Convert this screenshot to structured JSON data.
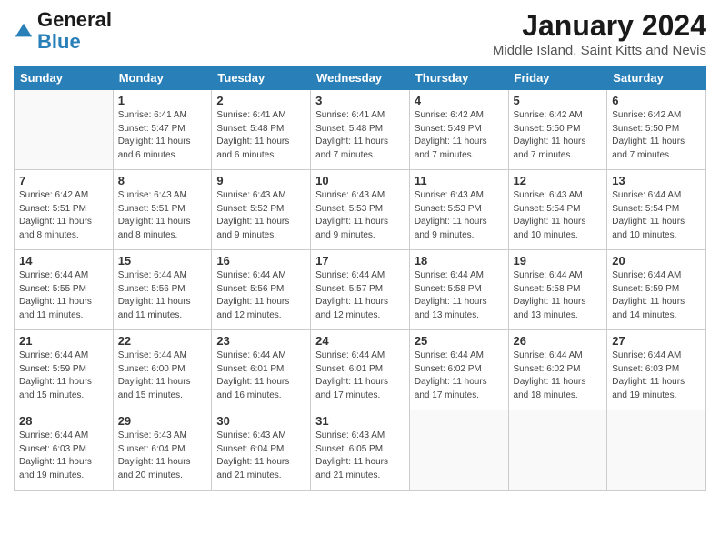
{
  "header": {
    "logo_line1": "General",
    "logo_line2": "Blue",
    "title": "January 2024",
    "subtitle": "Middle Island, Saint Kitts and Nevis"
  },
  "days_of_week": [
    "Sunday",
    "Monday",
    "Tuesday",
    "Wednesday",
    "Thursday",
    "Friday",
    "Saturday"
  ],
  "weeks": [
    [
      {
        "num": "",
        "sunrise": "",
        "sunset": "",
        "daylight": ""
      },
      {
        "num": "1",
        "sunrise": "6:41 AM",
        "sunset": "5:47 PM",
        "daylight": "11 hours and 6 minutes."
      },
      {
        "num": "2",
        "sunrise": "6:41 AM",
        "sunset": "5:48 PM",
        "daylight": "11 hours and 6 minutes."
      },
      {
        "num": "3",
        "sunrise": "6:41 AM",
        "sunset": "5:48 PM",
        "daylight": "11 hours and 7 minutes."
      },
      {
        "num": "4",
        "sunrise": "6:42 AM",
        "sunset": "5:49 PM",
        "daylight": "11 hours and 7 minutes."
      },
      {
        "num": "5",
        "sunrise": "6:42 AM",
        "sunset": "5:50 PM",
        "daylight": "11 hours and 7 minutes."
      },
      {
        "num": "6",
        "sunrise": "6:42 AM",
        "sunset": "5:50 PM",
        "daylight": "11 hours and 7 minutes."
      }
    ],
    [
      {
        "num": "7",
        "sunrise": "6:42 AM",
        "sunset": "5:51 PM",
        "daylight": "11 hours and 8 minutes."
      },
      {
        "num": "8",
        "sunrise": "6:43 AM",
        "sunset": "5:51 PM",
        "daylight": "11 hours and 8 minutes."
      },
      {
        "num": "9",
        "sunrise": "6:43 AM",
        "sunset": "5:52 PM",
        "daylight": "11 hours and 9 minutes."
      },
      {
        "num": "10",
        "sunrise": "6:43 AM",
        "sunset": "5:53 PM",
        "daylight": "11 hours and 9 minutes."
      },
      {
        "num": "11",
        "sunrise": "6:43 AM",
        "sunset": "5:53 PM",
        "daylight": "11 hours and 9 minutes."
      },
      {
        "num": "12",
        "sunrise": "6:43 AM",
        "sunset": "5:54 PM",
        "daylight": "11 hours and 10 minutes."
      },
      {
        "num": "13",
        "sunrise": "6:44 AM",
        "sunset": "5:54 PM",
        "daylight": "11 hours and 10 minutes."
      }
    ],
    [
      {
        "num": "14",
        "sunrise": "6:44 AM",
        "sunset": "5:55 PM",
        "daylight": "11 hours and 11 minutes."
      },
      {
        "num": "15",
        "sunrise": "6:44 AM",
        "sunset": "5:56 PM",
        "daylight": "11 hours and 11 minutes."
      },
      {
        "num": "16",
        "sunrise": "6:44 AM",
        "sunset": "5:56 PM",
        "daylight": "11 hours and 12 minutes."
      },
      {
        "num": "17",
        "sunrise": "6:44 AM",
        "sunset": "5:57 PM",
        "daylight": "11 hours and 12 minutes."
      },
      {
        "num": "18",
        "sunrise": "6:44 AM",
        "sunset": "5:58 PM",
        "daylight": "11 hours and 13 minutes."
      },
      {
        "num": "19",
        "sunrise": "6:44 AM",
        "sunset": "5:58 PM",
        "daylight": "11 hours and 13 minutes."
      },
      {
        "num": "20",
        "sunrise": "6:44 AM",
        "sunset": "5:59 PM",
        "daylight": "11 hours and 14 minutes."
      }
    ],
    [
      {
        "num": "21",
        "sunrise": "6:44 AM",
        "sunset": "5:59 PM",
        "daylight": "11 hours and 15 minutes."
      },
      {
        "num": "22",
        "sunrise": "6:44 AM",
        "sunset": "6:00 PM",
        "daylight": "11 hours and 15 minutes."
      },
      {
        "num": "23",
        "sunrise": "6:44 AM",
        "sunset": "6:01 PM",
        "daylight": "11 hours and 16 minutes."
      },
      {
        "num": "24",
        "sunrise": "6:44 AM",
        "sunset": "6:01 PM",
        "daylight": "11 hours and 17 minutes."
      },
      {
        "num": "25",
        "sunrise": "6:44 AM",
        "sunset": "6:02 PM",
        "daylight": "11 hours and 17 minutes."
      },
      {
        "num": "26",
        "sunrise": "6:44 AM",
        "sunset": "6:02 PM",
        "daylight": "11 hours and 18 minutes."
      },
      {
        "num": "27",
        "sunrise": "6:44 AM",
        "sunset": "6:03 PM",
        "daylight": "11 hours and 19 minutes."
      }
    ],
    [
      {
        "num": "28",
        "sunrise": "6:44 AM",
        "sunset": "6:03 PM",
        "daylight": "11 hours and 19 minutes."
      },
      {
        "num": "29",
        "sunrise": "6:43 AM",
        "sunset": "6:04 PM",
        "daylight": "11 hours and 20 minutes."
      },
      {
        "num": "30",
        "sunrise": "6:43 AM",
        "sunset": "6:04 PM",
        "daylight": "11 hours and 21 minutes."
      },
      {
        "num": "31",
        "sunrise": "6:43 AM",
        "sunset": "6:05 PM",
        "daylight": "11 hours and 21 minutes."
      },
      {
        "num": "",
        "sunrise": "",
        "sunset": "",
        "daylight": ""
      },
      {
        "num": "",
        "sunrise": "",
        "sunset": "",
        "daylight": ""
      },
      {
        "num": "",
        "sunrise": "",
        "sunset": "",
        "daylight": ""
      }
    ]
  ],
  "labels": {
    "sunrise_prefix": "Sunrise: ",
    "sunset_prefix": "Sunset: ",
    "daylight_prefix": "Daylight: "
  }
}
